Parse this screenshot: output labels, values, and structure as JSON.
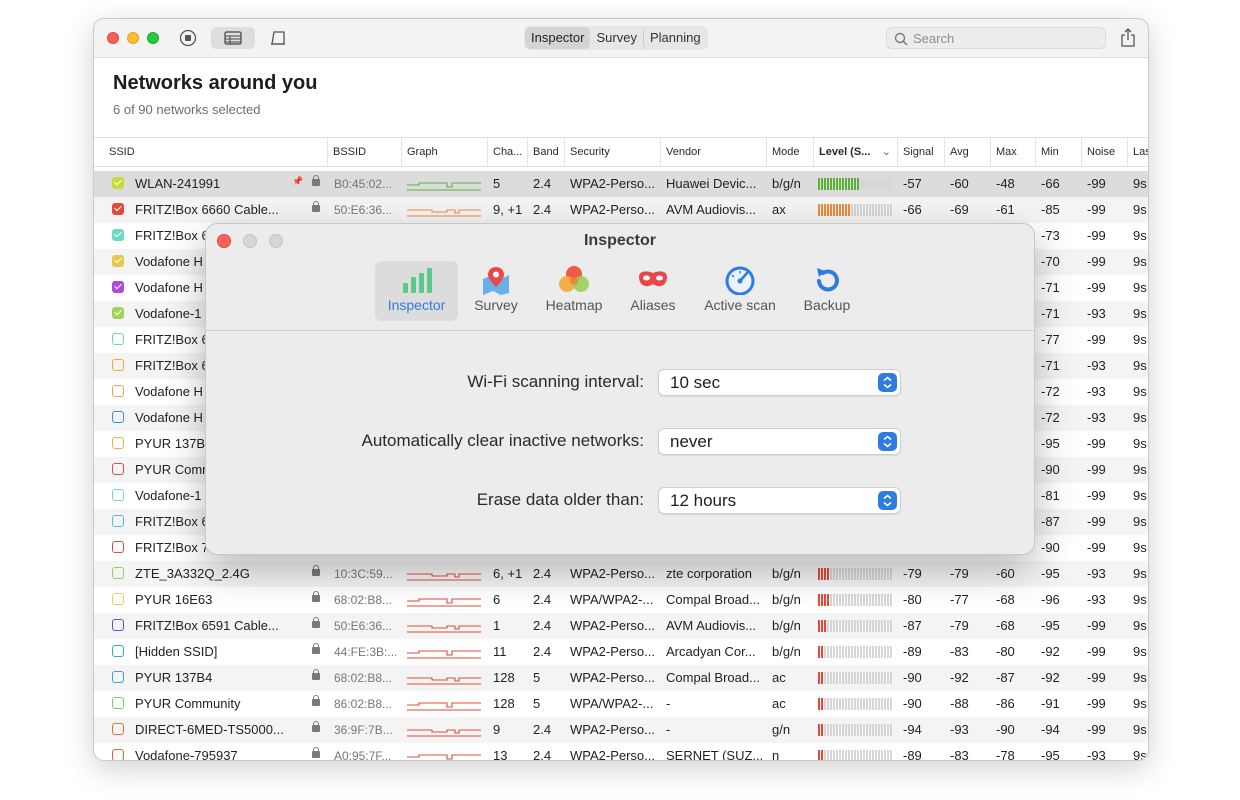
{
  "toolbar": {
    "tabs": [
      "Inspector",
      "Survey",
      "Planning"
    ],
    "active_tab": "Inspector",
    "search_placeholder": "Search"
  },
  "header": {
    "title": "Networks around you",
    "subtitle": "6 of 90 networks selected"
  },
  "table": {
    "columns": [
      "SSID",
      "BSSID",
      "Graph",
      "Cha...",
      "Band",
      "Security",
      "Vendor",
      "Mode",
      "Level (S...",
      "Signal",
      "Avg",
      "Max",
      "Min",
      "Noise",
      "Las"
    ],
    "rows": [
      {
        "ssid": "WLAN-241991",
        "bssid": "B0:45:02...",
        "channel": "5",
        "band": "2.4",
        "security": "WPA2-Perso...",
        "vendor": "Huawei Devic...",
        "mode": "b/g/n",
        "signal": "-57",
        "avg": "-60",
        "max": "-48",
        "min": "-66",
        "noise": "-99",
        "last": "9s",
        "color": "#c8d93a",
        "checked": true,
        "level": 0.55,
        "levelColor": "#5db13a",
        "selected": true
      },
      {
        "ssid": "FRITZ!Box 6660 Cable...",
        "bssid": "50:E6:36...",
        "channel": "9, +1",
        "band": "2.4",
        "security": "WPA2-Perso...",
        "vendor": "AVM Audiovis...",
        "mode": "ax",
        "signal": "-66",
        "avg": "-69",
        "max": "-61",
        "min": "-85",
        "noise": "-99",
        "last": "9s",
        "color": "#e04a3a",
        "checked": true,
        "level": 0.42,
        "levelColor": "#f08a3c"
      },
      {
        "ssid": "FRITZ!Box 6",
        "min": "-73",
        "noise": "-99",
        "last": "9s",
        "color": "#6fd9c4",
        "checked": true
      },
      {
        "ssid": "Vodafone H",
        "min": "-70",
        "noise": "-99",
        "last": "9s",
        "color": "#e5c94a",
        "checked": true
      },
      {
        "ssid": "Vodafone H",
        "min": "-71",
        "noise": "-99",
        "last": "9s",
        "color": "#b04ad9",
        "checked": true
      },
      {
        "ssid": "Vodafone-1",
        "min": "-71",
        "noise": "-93",
        "last": "9s",
        "color": "#9fd45a",
        "checked": true
      },
      {
        "ssid": "FRITZ!Box 6",
        "min": "-77",
        "noise": "-99",
        "last": "9s",
        "color": "#6fd9a6",
        "checked": false
      },
      {
        "ssid": "FRITZ!Box 6",
        "min": "-71",
        "noise": "-93",
        "last": "9s",
        "color": "#f0a93a",
        "checked": false
      },
      {
        "ssid": "Vodafone H",
        "min": "-72",
        "noise": "-93",
        "last": "9s",
        "color": "#f0a060",
        "checked": false
      },
      {
        "ssid": "Vodafone H",
        "min": "-72",
        "noise": "-93",
        "last": "9s",
        "color": "#3a8ee0",
        "checked": false
      },
      {
        "ssid": "PYUR 137B",
        "min": "-95",
        "noise": "-99",
        "last": "9s",
        "color": "#f0b040",
        "checked": false
      },
      {
        "ssid": "PYUR Comm",
        "min": "-90",
        "noise": "-99",
        "last": "9s",
        "color": "#d94a5a",
        "checked": false
      },
      {
        "ssid": "Vodafone-1",
        "min": "-81",
        "noise": "-99",
        "last": "9s",
        "color": "#6fd9d0",
        "checked": false
      },
      {
        "ssid": "FRITZ!Box 6",
        "min": "-87",
        "noise": "-99",
        "last": "9s",
        "color": "#4ac0d9",
        "checked": false
      },
      {
        "ssid": "FRITZ!Box 7",
        "min": "-90",
        "noise": "-99",
        "last": "9s",
        "color": "#d94a4a",
        "checked": false
      },
      {
        "ssid": "ZTE_3A332Q_2.4G",
        "bssid": "10:3C:59...",
        "channel": "6, +1",
        "band": "2.4",
        "security": "WPA2-Perso...",
        "vendor": "zte corporation",
        "mode": "b/g/n",
        "signal": "-79",
        "avg": "-79",
        "max": "-60",
        "min": "-95",
        "noise": "-93",
        "last": "9s",
        "color": "#8fd45a",
        "checked": false,
        "level": 0.15,
        "levelColor": "#e04a3a"
      },
      {
        "ssid": "PYUR 16E63",
        "bssid": "68:02:B8...",
        "channel": "6",
        "band": "2.4",
        "security": "WPA/WPA2-...",
        "vendor": "Compal Broad...",
        "mode": "b/g/n",
        "signal": "-80",
        "avg": "-77",
        "max": "-68",
        "min": "-96",
        "noise": "-93",
        "last": "9s",
        "color": "#d9d94a",
        "checked": false,
        "level": 0.15,
        "levelColor": "#e04a3a"
      },
      {
        "ssid": "FRITZ!Box 6591 Cable...",
        "bssid": "50:E6:36...",
        "channel": "1",
        "band": "2.4",
        "security": "WPA2-Perso...",
        "vendor": "AVM Audiovis...",
        "mode": "b/g/n",
        "signal": "-87",
        "avg": "-79",
        "max": "-68",
        "min": "-95",
        "noise": "-99",
        "last": "9s",
        "color": "#6a4ad9",
        "checked": false,
        "level": 0.1,
        "levelColor": "#e04a3a"
      },
      {
        "ssid": "[Hidden SSID]",
        "bssid": "44:FE:3B:...",
        "channel": "11",
        "band": "2.4",
        "security": "WPA2-Perso...",
        "vendor": "Arcadyan Cor...",
        "mode": "b/g/n",
        "signal": "-89",
        "avg": "-83",
        "max": "-80",
        "min": "-92",
        "noise": "-99",
        "last": "9s",
        "color": "#3aa6c9",
        "checked": false,
        "level": 0.08,
        "levelColor": "#e04a3a"
      },
      {
        "ssid": "PYUR 137B4",
        "bssid": "68:02:B8...",
        "channel": "128",
        "band": "5",
        "security": "WPA2-Perso...",
        "vendor": "Compal Broad...",
        "mode": "ac",
        "signal": "-90",
        "avg": "-92",
        "max": "-87",
        "min": "-92",
        "noise": "-99",
        "last": "9s",
        "color": "#3a9ed9",
        "checked": false,
        "level": 0.08,
        "levelColor": "#e04a3a"
      },
      {
        "ssid": "PYUR Community",
        "bssid": "86:02:B8...",
        "channel": "128",
        "band": "5",
        "security": "WPA/WPA2-...",
        "vendor": "-",
        "mode": "ac",
        "signal": "-90",
        "avg": "-88",
        "max": "-86",
        "min": "-91",
        "noise": "-99",
        "last": "9s",
        "color": "#7ad45a",
        "checked": false,
        "level": 0.08,
        "levelColor": "#e04a3a"
      },
      {
        "ssid": "DIRECT-6MED-TS5000...",
        "bssid": "36:9F:7B...",
        "channel": "9",
        "band": "2.4",
        "security": "WPA2-Perso...",
        "vendor": "-",
        "mode": "g/n",
        "signal": "-94",
        "avg": "-93",
        "max": "-90",
        "min": "-94",
        "noise": "-99",
        "last": "9s",
        "color": "#e0703a",
        "checked": false,
        "level": 0.06,
        "levelColor": "#e04a3a"
      },
      {
        "ssid": "Vodafone-795937",
        "bssid": "A0:95:7F...",
        "channel": "13",
        "band": "2.4",
        "security": "WPA2-Perso...",
        "vendor": "SERNET (SUZ...",
        "mode": "n",
        "signal": "-89",
        "avg": "-83",
        "max": "-78",
        "min": "-95",
        "noise": "-93",
        "last": "9s",
        "color": "#e0603a",
        "checked": false,
        "level": 0.08,
        "levelColor": "#e04a3a"
      }
    ]
  },
  "dialog": {
    "title": "Inspector",
    "panes": [
      "Inspector",
      "Survey",
      "Heatmap",
      "Aliases",
      "Active scan",
      "Backup"
    ],
    "active_pane": "Inspector",
    "settings": [
      {
        "label": "Wi-Fi scanning interval:",
        "value": "10 sec"
      },
      {
        "label": "Automatically clear inactive networks:",
        "value": "never"
      },
      {
        "label": "Erase data older than:",
        "value": "12 hours"
      }
    ]
  },
  "colors": {
    "accent": "#2f7be0",
    "close": "#fe5f57",
    "minimize": "#febc2e",
    "zoom": "#28c840"
  }
}
